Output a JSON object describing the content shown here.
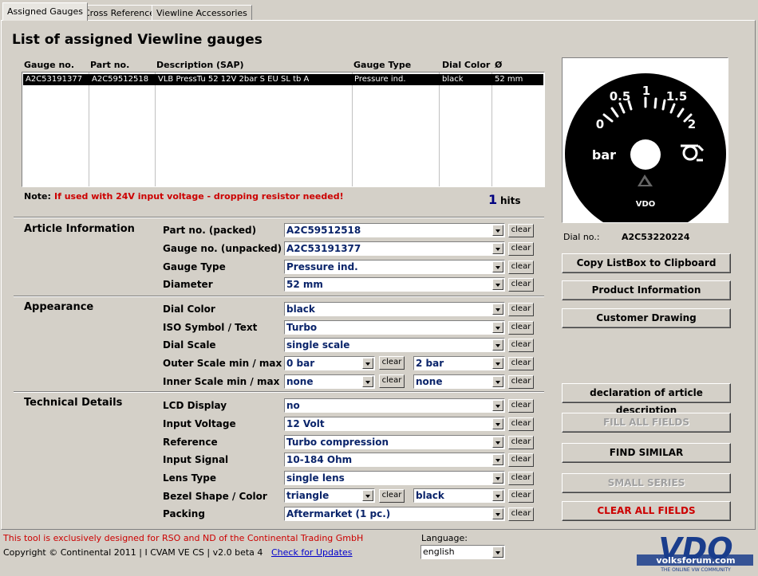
{
  "tabs": [
    "Assigned Gauges",
    "Cross Reference",
    "Viewline Accessories"
  ],
  "page_title": "List of assigned Viewline gauges",
  "listbox": {
    "columns": [
      "Gauge no.",
      "Part no.",
      "Description (SAP)",
      "Gauge Type",
      "Dial Color",
      "Ø"
    ],
    "rows": [
      [
        "A2C53191377",
        "A2C59512518",
        "VLB PressTu 52 12V 2bar S EU SL tb A",
        "Pressure ind.",
        "black",
        "52 mm"
      ]
    ]
  },
  "note": {
    "label": "Note:",
    "text": "If used with 24V input voltage - dropping resistor needed!"
  },
  "hits": {
    "count": "1",
    "label": "hits"
  },
  "clear_label": "clear",
  "sections": {
    "article": "Article Information",
    "appearance": "Appearance",
    "technical": "Technical Details"
  },
  "fields": {
    "part_no": {
      "label": "Part no. (packed)",
      "value": "A2C59512518"
    },
    "gauge_no": {
      "label": "Gauge no. (unpacked)",
      "value": "A2C53191377"
    },
    "gauge_type": {
      "label": "Gauge Type",
      "value": "Pressure ind."
    },
    "diameter": {
      "label": "Diameter",
      "value": "52 mm"
    },
    "dial_color": {
      "label": "Dial Color",
      "value": "black"
    },
    "iso_symbol": {
      "label": "ISO Symbol / Text",
      "value": "Turbo"
    },
    "dial_scale": {
      "label": "Dial Scale",
      "value": "single scale"
    },
    "outer_scale": {
      "label": "Outer Scale min / max",
      "min": "0 bar",
      "max": "2 bar"
    },
    "inner_scale": {
      "label": "Inner Scale min / max",
      "min": "none",
      "max": "none"
    },
    "lcd_display": {
      "label": "LCD Display",
      "value": "no"
    },
    "input_voltage": {
      "label": "Input Voltage",
      "value": "12 Volt"
    },
    "reference": {
      "label": "Reference",
      "value": "Turbo compression"
    },
    "input_signal": {
      "label": "Input Signal",
      "value": "10-184 Ohm"
    },
    "lens_type": {
      "label": "Lens Type",
      "value": "single lens"
    },
    "bezel": {
      "label": "Bezel Shape / Color",
      "shape": "triangle",
      "color": "black"
    },
    "packing": {
      "label": "Packing",
      "value": "Aftermarket (1 pc.)"
    }
  },
  "gauge": {
    "scale_labels": [
      "0",
      "0.5",
      "1",
      "1.5",
      "2"
    ],
    "unit": "bar",
    "brand": "VDO"
  },
  "dial_no": {
    "label": "Dial no.:",
    "value": "A2C53220224"
  },
  "right_buttons": {
    "copy": "Copy ListBox to Clipboard",
    "product_info": "Product Information",
    "customer_drawing": "Customer Drawing",
    "declaration": "declaration of article description",
    "fill_all": "FILL ALL FIELDS",
    "find_similar": "FIND SIMILAR",
    "small_series": "SMALL SERIES",
    "clear_all": "CLEAR ALL FIELDS"
  },
  "footer": {
    "notice": "This tool is exclusively designed for RSO and ND of the Continental Trading GmbH",
    "copyright": "Copyright © Continental 2011 | I CVAM VE CS | v2.0 beta 4",
    "check_updates": "Check for Updates",
    "language_label": "Language:",
    "language_value": "english"
  },
  "logo": {
    "main": "VDO",
    "watermark": "volksforum.com",
    "tagline": "THE ONLINE VW COMMUNITY"
  },
  "colors": {
    "window_bg": "#d4d0c8",
    "accent_red": "#cc0000",
    "value_blue": "#0a246a",
    "link_blue": "#0000cc",
    "logo_blue": "#1a3d8c"
  }
}
